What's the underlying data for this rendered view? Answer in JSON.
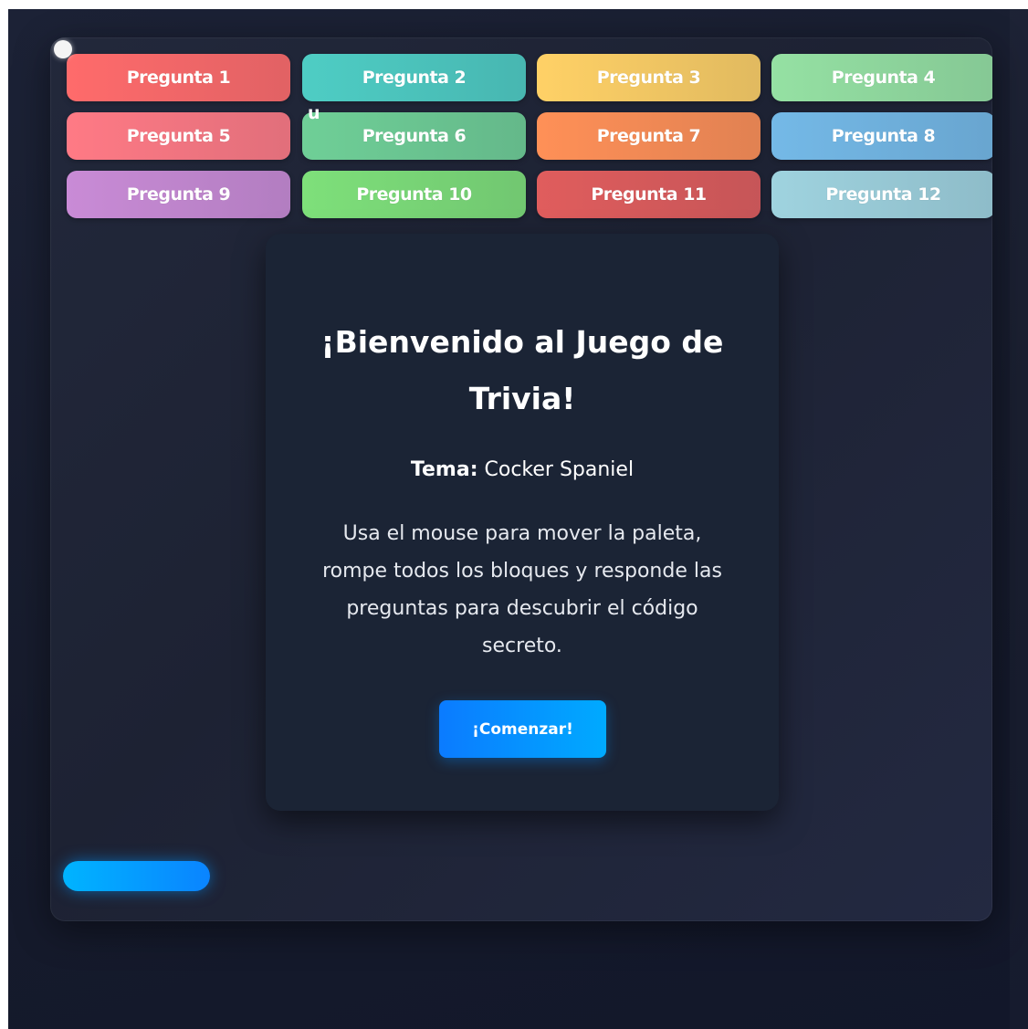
{
  "game": {
    "stray_letter": "u",
    "blocks": [
      {
        "label": "Pregunta 1",
        "color": "#ff6b6b"
      },
      {
        "label": "Pregunta 2",
        "color": "#4ecdc4"
      },
      {
        "label": "Pregunta 3",
        "color": "#ffd166"
      },
      {
        "label": "Pregunta 4",
        "color": "#95e1a3"
      },
      {
        "label": "Pregunta 5",
        "color": "#ff7a85"
      },
      {
        "label": "Pregunta 6",
        "color": "#6fcf97"
      },
      {
        "label": "Pregunta 7",
        "color": "#ff9057"
      },
      {
        "label": "Pregunta 8",
        "color": "#74b9e7"
      },
      {
        "label": "Pregunta 9",
        "color": "#c98bd6"
      },
      {
        "label": "Pregunta 10",
        "color": "#7ee07a"
      },
      {
        "label": "Pregunta 11",
        "color": "#e05d5d"
      },
      {
        "label": "Pregunta 12",
        "color": "#9fd3df"
      }
    ],
    "accent": "#0b84ff"
  },
  "modal": {
    "title": "¡Bienvenido al Juego de Trivia!",
    "topic_label": "Tema:",
    "topic_value": "Cocker Spaniel",
    "instructions": "Usa el mouse para mover la paleta, rompe todos los bloques y responde las preguntas para descubrir el código secreto.",
    "start_button": "¡Comenzar!"
  }
}
